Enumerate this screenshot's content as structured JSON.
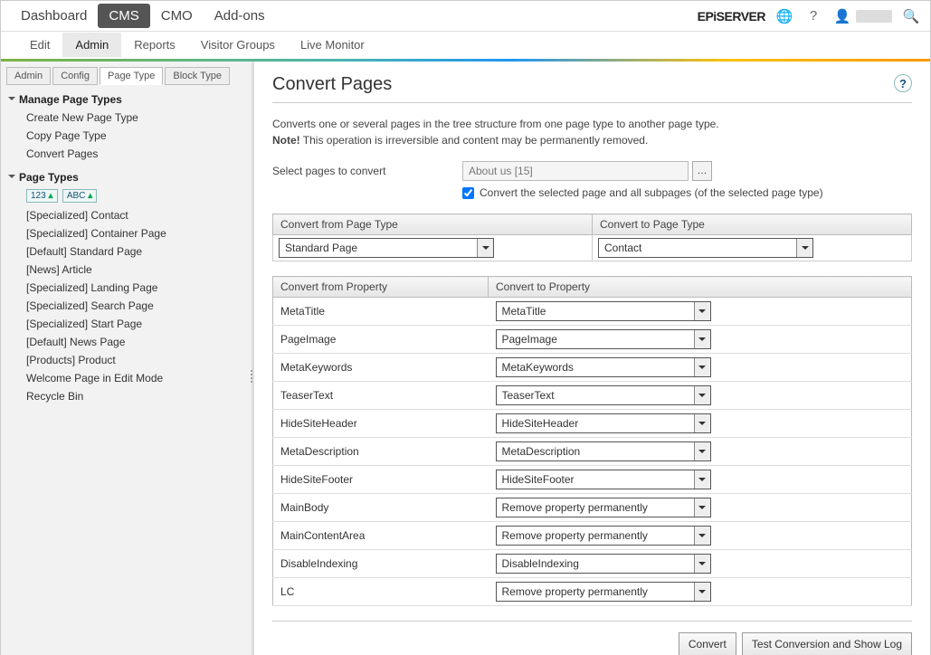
{
  "topnav": {
    "items": [
      "Dashboard",
      "CMS",
      "CMO",
      "Add-ons"
    ],
    "active": 1
  },
  "brand": "EPiSERVER",
  "submenu": {
    "items": [
      "Edit",
      "Admin",
      "Reports",
      "Visitor Groups",
      "Live Monitor"
    ],
    "active": 1
  },
  "sidebar": {
    "tabs": [
      "Admin",
      "Config",
      "Page Type",
      "Block Type"
    ],
    "activeTab": 2,
    "group1": {
      "title": "Manage Page Types",
      "items": [
        "Create New Page Type",
        "Copy Page Type",
        "Convert Pages"
      ]
    },
    "group2": {
      "title": "Page Types",
      "sort1": "123",
      "sort2": "ABC",
      "items": [
        "[Specialized] Contact",
        "[Specialized] Container Page",
        "[Default] Standard Page",
        "[News] Article",
        "[Specialized] Landing Page",
        "[Specialized] Search Page",
        "[Specialized] Start Page",
        "[Default] News Page",
        "[Products] Product",
        "Welcome Page in Edit Mode",
        "Recycle Bin"
      ]
    }
  },
  "main": {
    "heading": "Convert Pages",
    "intro_line1": "Converts one or several pages in the tree structure from one page type to another page type.",
    "intro_note_label": "Note!",
    "intro_note_text": " This operation is irreversible and content may be permanently removed.",
    "select_label": "Select pages to convert",
    "page_field": "About us [15]",
    "checkbox_label": "Convert the selected page and all subpages (of the selected page type)",
    "checkbox_checked": true,
    "from_type_header": "Convert from Page Type",
    "to_type_header": "Convert to Page Type",
    "from_type_value": "Standard Page",
    "to_type_value": "Contact",
    "from_prop_header": "Convert from Property",
    "to_prop_header": "Convert to Property",
    "props": [
      {
        "from": "MetaTitle",
        "to": "MetaTitle"
      },
      {
        "from": "PageImage",
        "to": "PageImage"
      },
      {
        "from": "MetaKeywords",
        "to": "MetaKeywords"
      },
      {
        "from": "TeaserText",
        "to": "TeaserText"
      },
      {
        "from": "HideSiteHeader",
        "to": "HideSiteHeader"
      },
      {
        "from": "MetaDescription",
        "to": "MetaDescription"
      },
      {
        "from": "HideSiteFooter",
        "to": "HideSiteFooter"
      },
      {
        "from": "MainBody",
        "to": "Remove property permanently"
      },
      {
        "from": "MainContentArea",
        "to": "Remove property permanently"
      },
      {
        "from": "DisableIndexing",
        "to": "DisableIndexing"
      },
      {
        "from": "LC",
        "to": "Remove property permanently"
      }
    ],
    "btn_convert": "Convert",
    "btn_test": "Test Conversion and Show Log"
  }
}
